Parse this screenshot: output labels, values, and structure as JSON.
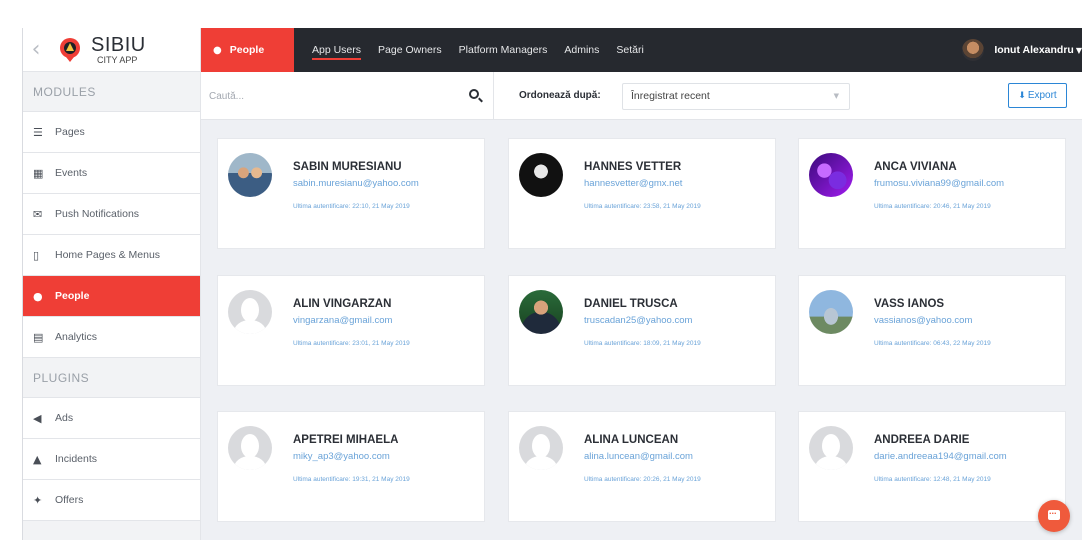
{
  "brand": {
    "name": "SIBIU",
    "sub": "CITY APP"
  },
  "sidebar": {
    "modules_label": "MODULES",
    "plugins_label": "PLUGINS",
    "modules": [
      {
        "label": "Pages",
        "icon": "list-icon"
      },
      {
        "label": "Events",
        "icon": "calendar-icon"
      },
      {
        "label": "Push Notifications",
        "icon": "envelope-icon"
      },
      {
        "label": "Home Pages & Menus",
        "icon": "mobile-icon"
      },
      {
        "label": "People",
        "icon": "user-icon",
        "active": true
      },
      {
        "label": "Analytics",
        "icon": "chart-icon"
      }
    ],
    "plugins": [
      {
        "label": "Ads",
        "icon": "megaphone-icon"
      },
      {
        "label": "Incidents",
        "icon": "warning-icon"
      },
      {
        "label": "Offers",
        "icon": "tag-icon"
      }
    ]
  },
  "topbar": {
    "active_tab": "People",
    "tabs": [
      "App Users",
      "Page Owners",
      "Platform Managers",
      "Admins",
      "Setări"
    ],
    "user_name": "Ionut Alexandru"
  },
  "filters": {
    "search_placeholder": "Caută...",
    "sort_label": "Ordonează după:",
    "sort_value": "Înregistrat recent",
    "export_label": "Export"
  },
  "people": [
    {
      "name": "SABIN MURESIANU",
      "email": "sabin.muresianu@yahoo.com",
      "last_login": "Ultima autentificare: 22:10, 21 May 2019"
    },
    {
      "name": "HANNES VETTER",
      "email": "hannesvetter@gmx.net",
      "last_login": "Ultima autentificare: 23:58, 21 May 2019"
    },
    {
      "name": "ANCA VIVIANA",
      "email": "frumosu.viviana99@gmail.com",
      "last_login": "Ultima autentificare: 20:46, 21 May 2019"
    },
    {
      "name": "ALIN VINGARZAN",
      "email": "vingarzana@gmail.com",
      "last_login": "Ultima autentificare: 23:01, 21 May 2019"
    },
    {
      "name": "DANIEL TRUSCA",
      "email": "truscadan25@yahoo.com",
      "last_login": "Ultima autentificare: 18:09, 21 May 2019"
    },
    {
      "name": "VASS IANOS",
      "email": "vassianos@yahoo.com",
      "last_login": "Ultima autentificare: 06:43, 22 May 2019"
    },
    {
      "name": "APETREI MIHAELA",
      "email": "miky_ap3@yahoo.com",
      "last_login": "Ultima autentificare: 19:31, 21 May 2019"
    },
    {
      "name": "ALINA LUNCEAN",
      "email": "alina.luncean@gmail.com",
      "last_login": "Ultima autentificare: 20:26, 21 May 2019"
    },
    {
      "name": "ANDREEA DARIE",
      "email": "darie.andreeaa194@gmail.com",
      "last_login": "Ultima autentificare: 12:48, 21 May 2019"
    }
  ],
  "colors": {
    "accent": "#ef3e36",
    "topbar": "#26292f",
    "link": "#6aa3d8",
    "export": "#2b86d6"
  }
}
